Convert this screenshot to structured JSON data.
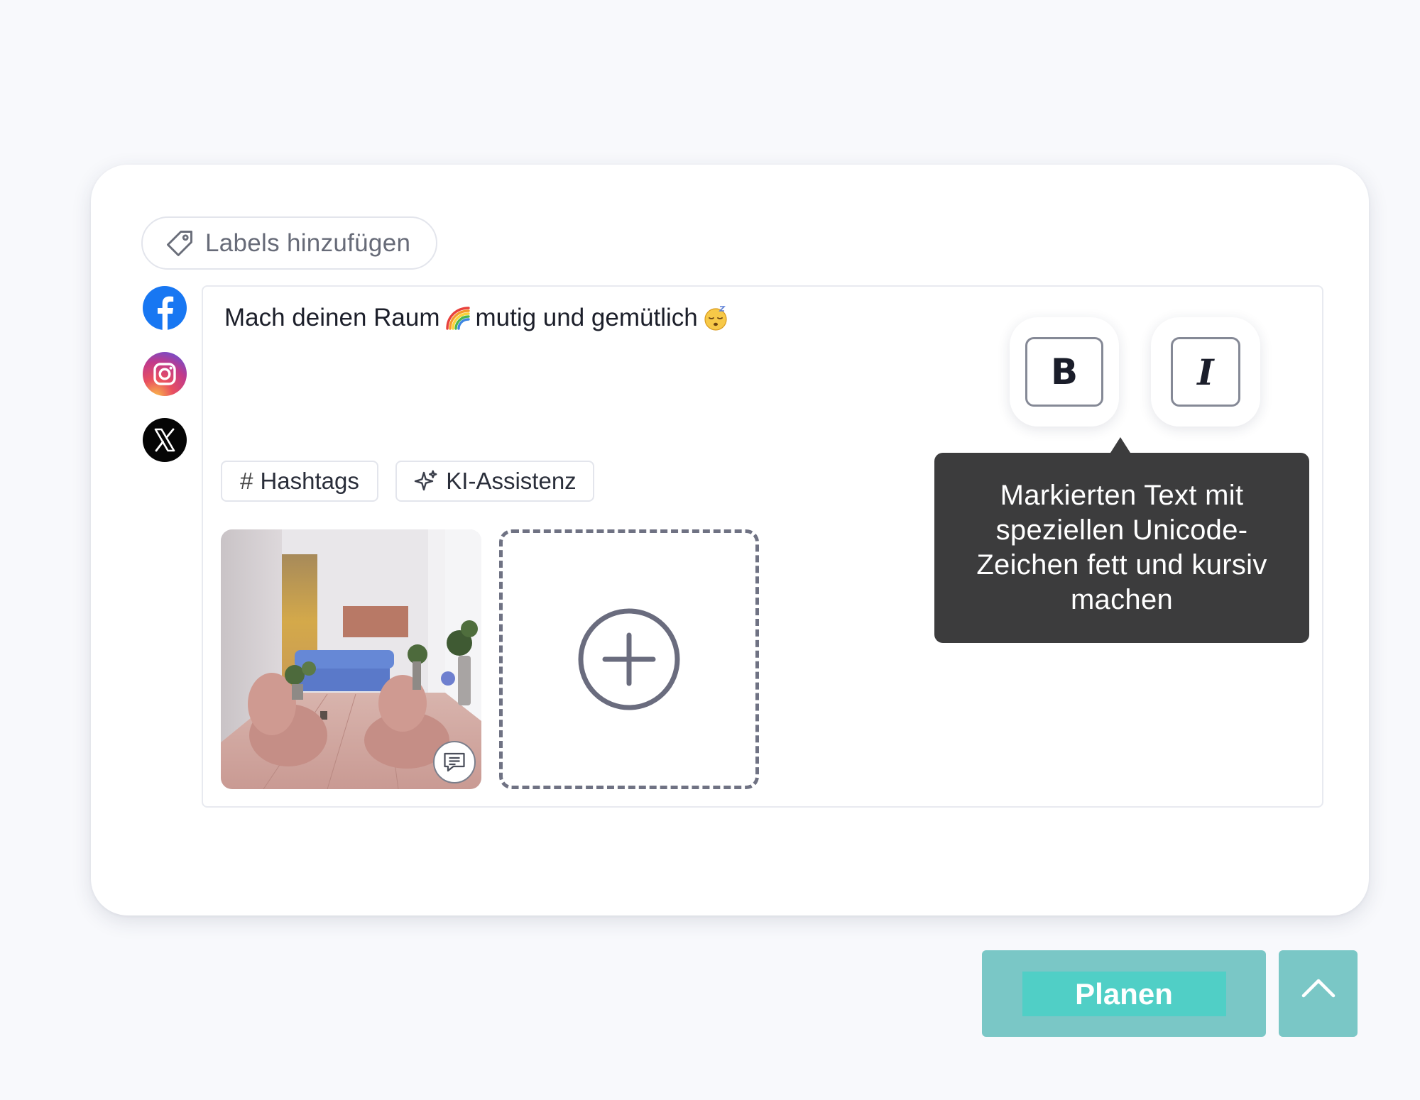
{
  "labels": {
    "add_label": "Labels hinzufügen"
  },
  "networks": [
    {
      "name": "Facebook",
      "color": "#1877f2"
    },
    {
      "name": "Instagram",
      "color": "#e1306c"
    },
    {
      "name": "X",
      "color": "#000000"
    }
  ],
  "post": {
    "text_part1": "Mach deinen Raum",
    "text_part2": "mutig und gemütlich",
    "emoji1": "rainbow-emoji",
    "emoji2": "sleepy-face-emoji"
  },
  "tools": {
    "hashtags_symbol": "#",
    "hashtags_label": "Hashtags",
    "ai_label": "KI-Assistenz"
  },
  "formatting": {
    "bold_label": "B",
    "italic_label": "I",
    "tooltip": "Markierten Text mit speziellen Unicode-Zeichen fett und kursiv machen"
  },
  "actions": {
    "plan_label": "Planen"
  },
  "colors": {
    "accent_teal": "#7ac7c6",
    "accent_teal_bright": "#50cfc6",
    "tooltip_bg": "#3c3c3d"
  }
}
